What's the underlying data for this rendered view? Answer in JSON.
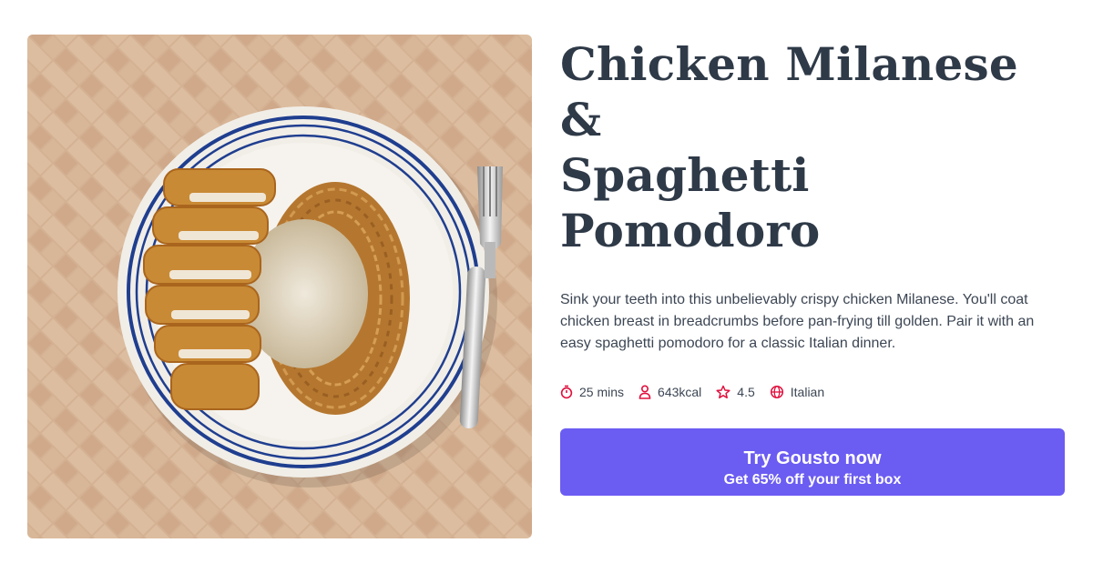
{
  "recipe": {
    "title_line1": "Chicken Milanese &",
    "title_line2": "Spaghetti Pomodoro",
    "description": "Sink your teeth into this unbelievably crispy chicken Milanese. You'll coat chicken breast in breadcrumbs before pan-frying till golden. Pair it with an easy spaghetti pomodoro for a classic Italian dinner."
  },
  "meta": [
    {
      "icon": "timer-icon",
      "label": "25 mins"
    },
    {
      "icon": "person-icon",
      "label": "643kcal"
    },
    {
      "icon": "star-icon",
      "label": "4.5"
    },
    {
      "icon": "globe-icon",
      "label": "Italian"
    }
  ],
  "cta": {
    "main_label": "Try Gousto now",
    "sub_label": "Get 65% off your first box"
  },
  "colors": {
    "accent": "#6b5cf2",
    "icon": "#e0103d",
    "title": "#2f3a48"
  }
}
